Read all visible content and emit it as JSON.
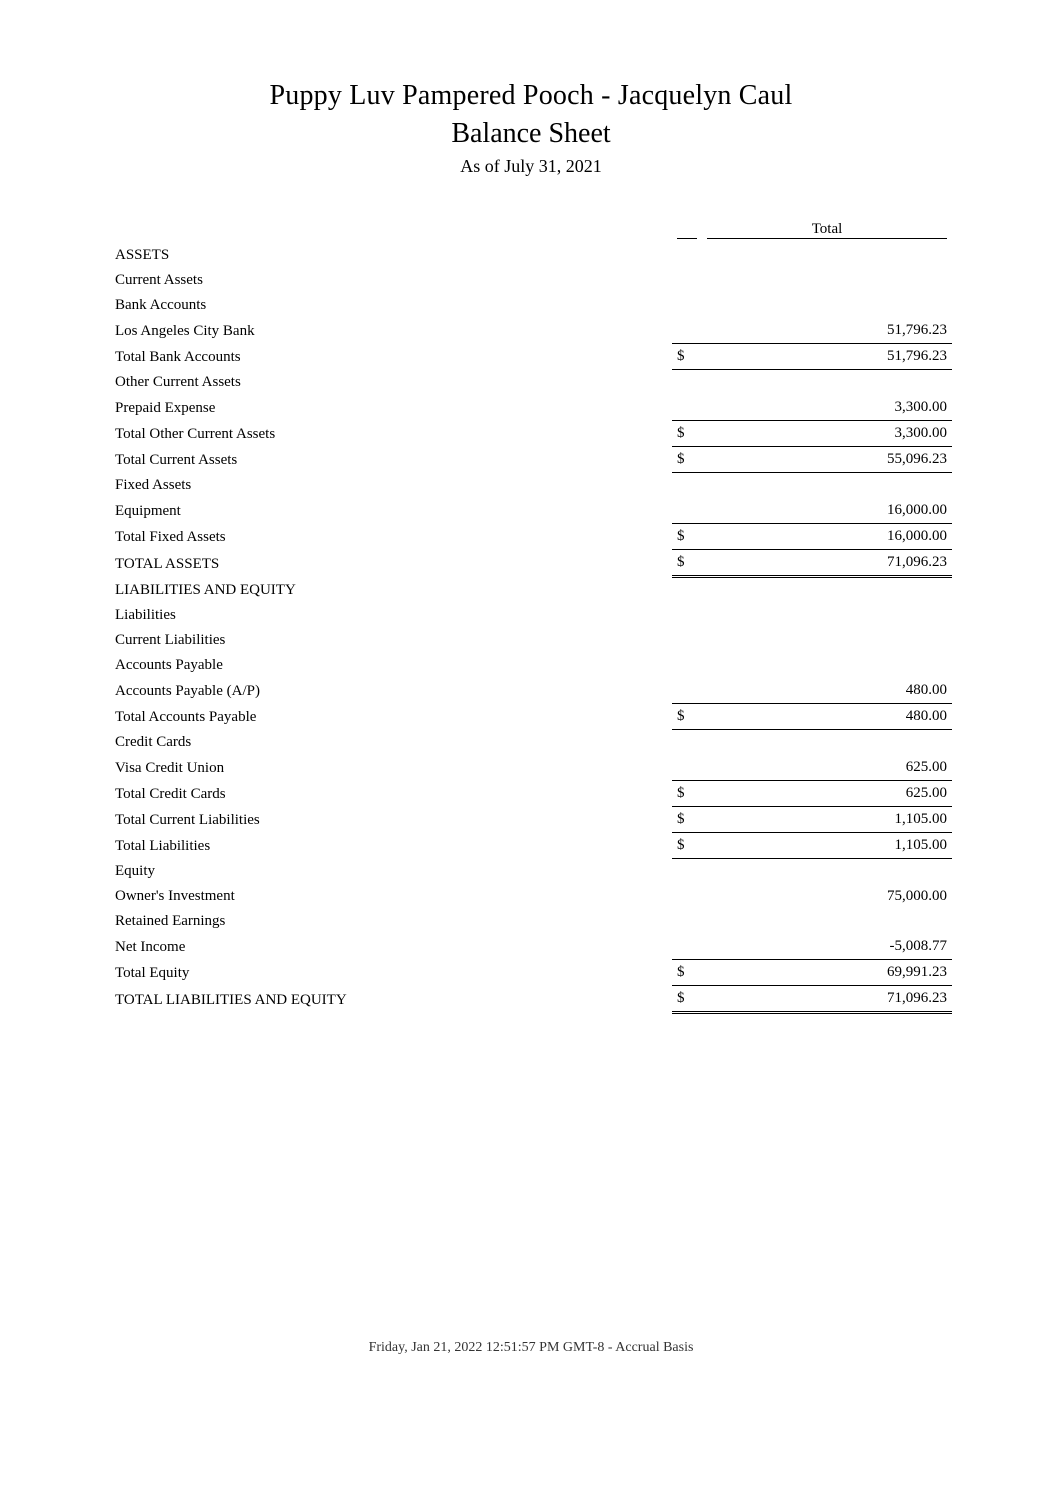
{
  "header": {
    "company": "Puppy Luv Pampered Pooch - Jacquelyn Caul",
    "title": "Balance Sheet",
    "asof": "As of July 31, 2021"
  },
  "column_header": "Total",
  "rows": [
    {
      "label": "ASSETS",
      "indent": 0
    },
    {
      "label": "Current Assets",
      "indent": 1
    },
    {
      "label": "Bank Accounts",
      "indent": 2
    },
    {
      "label": "Los Angeles City Bank",
      "indent": 3,
      "amount": "51,796.23",
      "style": "underline"
    },
    {
      "label": "Total Bank Accounts",
      "indent": 2,
      "currency": "$",
      "amount": "51,796.23",
      "style": "underline"
    },
    {
      "label": "Other Current Assets",
      "indent": 2
    },
    {
      "label": "Prepaid Expense",
      "indent": 3,
      "amount": "3,300.00",
      "style": "underline"
    },
    {
      "label": "Total Other Current Assets",
      "indent": 2,
      "currency": "$",
      "amount": "3,300.00",
      "style": "underline"
    },
    {
      "label": "Total Current Assets",
      "indent": 1,
      "currency": "$",
      "amount": "55,096.23",
      "style": "underline"
    },
    {
      "label": "Fixed Assets",
      "indent": 1
    },
    {
      "label": "Equipment",
      "indent": 2,
      "amount": "16,000.00",
      "style": "underline"
    },
    {
      "label": "Total Fixed Assets",
      "indent": 1,
      "currency": "$",
      "amount": "16,000.00",
      "style": "underline"
    },
    {
      "label": "TOTAL ASSETS",
      "indent": 0,
      "currency": "$",
      "amount": "71,096.23",
      "style": "dblunderline"
    },
    {
      "label": "LIABILITIES AND EQUITY",
      "indent": 0
    },
    {
      "label": "Liabilities",
      "indent": 1
    },
    {
      "label": "Current Liabilities",
      "indent": 2
    },
    {
      "label": "Accounts Payable",
      "indent": 3
    },
    {
      "label": "Accounts Payable (A/P)",
      "indent": 4,
      "amount": "480.00",
      "style": "underline"
    },
    {
      "label": "Total Accounts Payable",
      "indent": 3,
      "currency": "$",
      "amount": "480.00",
      "style": "underline"
    },
    {
      "label": "Credit Cards",
      "indent": 3
    },
    {
      "label": "Visa Credit Union",
      "indent": 4,
      "amount": "625.00",
      "style": "underline"
    },
    {
      "label": "Total Credit Cards",
      "indent": 3,
      "currency": "$",
      "amount": "625.00",
      "style": "underline"
    },
    {
      "label": "Total Current Liabilities",
      "indent": 2,
      "currency": "$",
      "amount": "1,105.00",
      "style": "underline"
    },
    {
      "label": "Total Liabilities",
      "indent": 1,
      "currency": "$",
      "amount": "1,105.00",
      "style": "underline"
    },
    {
      "label": "Equity",
      "indent": 1
    },
    {
      "label": "Owner's Investment",
      "indent": 2,
      "amount": "75,000.00"
    },
    {
      "label": "Retained Earnings",
      "indent": 2
    },
    {
      "label": "Net Income",
      "indent": 2,
      "amount": "-5,008.77",
      "style": "underline"
    },
    {
      "label": "Total Equity",
      "indent": 1,
      "currency": "$",
      "amount": "69,991.23",
      "style": "underline"
    },
    {
      "label": "TOTAL LIABILITIES AND EQUITY",
      "indent": 0,
      "currency": "$",
      "amount": "71,096.23",
      "style": "dblunderline"
    }
  ],
  "footer": "Friday, Jan 21, 2022 12:51:57 PM GMT-8 - Accrual Basis"
}
